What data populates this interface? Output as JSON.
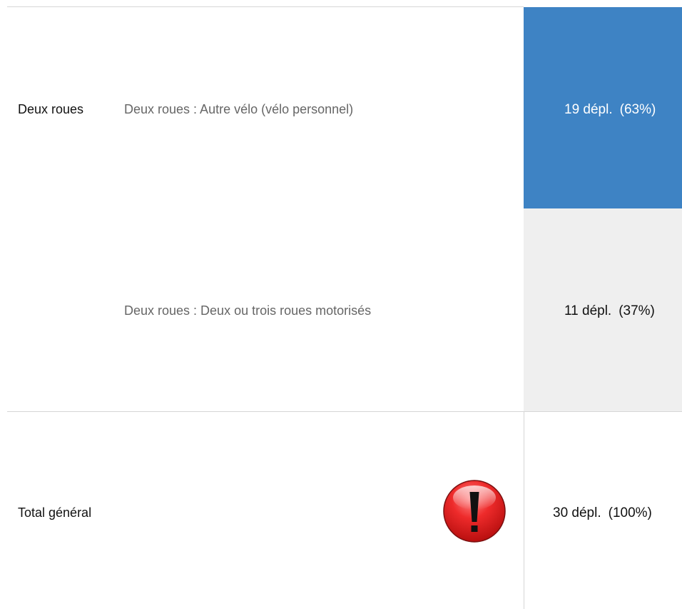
{
  "rows": [
    {
      "group": "Deux roues",
      "category": "Deux roues : Autre vélo (vélo personnel)",
      "count": "19 dépl.",
      "percent": "(63%)"
    },
    {
      "group": "",
      "category": "Deux roues : Deux ou trois roues motorisés",
      "count": "11 dépl.",
      "percent": "(37%)"
    }
  ],
  "total": {
    "label": "Total général",
    "count": "30 dépl.",
    "percent": "(100%)"
  },
  "icons": {
    "warning": "exclamation-warning-icon"
  },
  "colors": {
    "highlight": "#3e83c4",
    "row_alt": "#efefef",
    "warning_red": "#e02020"
  }
}
